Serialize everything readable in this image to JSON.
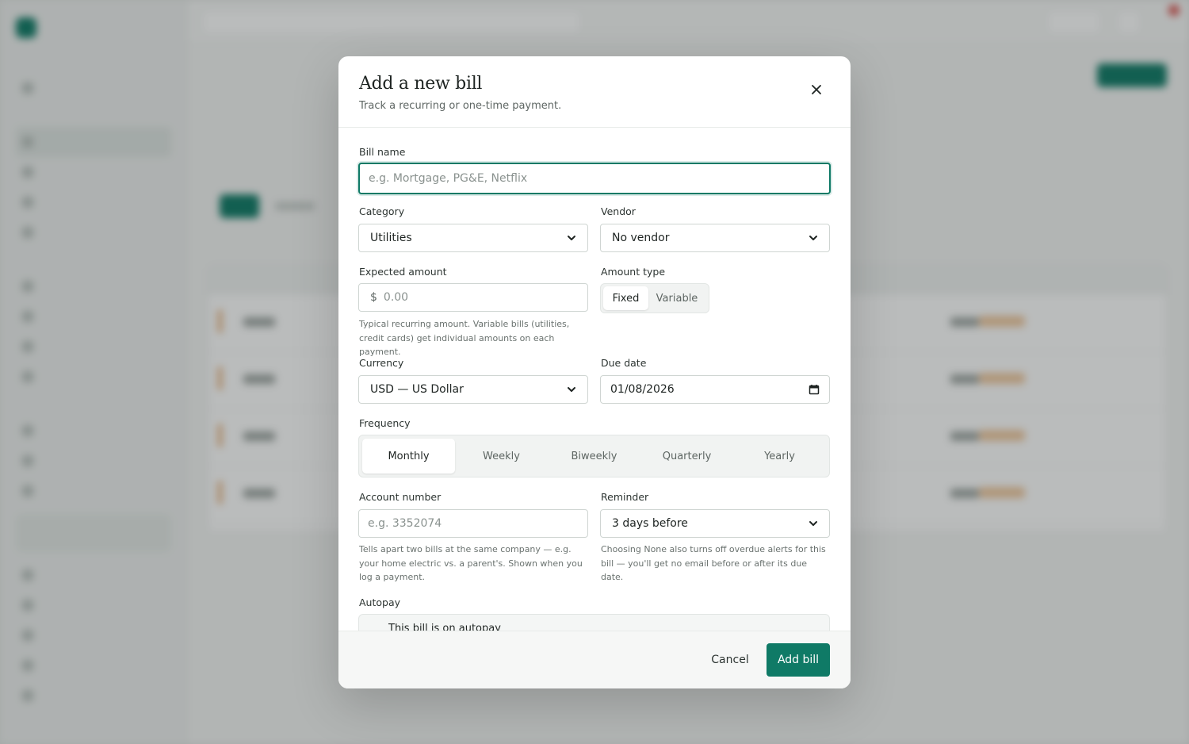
{
  "modal": {
    "title": "Add a new bill",
    "subtitle": "Track a recurring or one-time payment.",
    "close_icon": "close-icon"
  },
  "form": {
    "bill_name": {
      "label": "Bill name",
      "placeholder": "e.g. Mortgage, PG&E, Netflix",
      "value": ""
    },
    "category": {
      "label": "Category",
      "value": "Utilities"
    },
    "vendor": {
      "label": "Vendor",
      "value": "No vendor"
    },
    "expected_amount": {
      "label": "Expected amount",
      "currency_symbol": "$",
      "placeholder": "0.00",
      "help": "Typical recurring amount. Variable bills (utilities, credit cards) get individual amounts on each payment."
    },
    "amount_type": {
      "label": "Amount type",
      "options": [
        "Fixed",
        "Variable"
      ],
      "selected": "Fixed"
    },
    "currency": {
      "label": "Currency",
      "value": "USD — US Dollar"
    },
    "due_date": {
      "label": "Due date",
      "value": "01/08/2026",
      "icon": "calendar-icon"
    },
    "frequency": {
      "label": "Frequency",
      "options": [
        "Monthly",
        "Weekly",
        "Biweekly",
        "Quarterly",
        "Yearly"
      ],
      "selected": "Monthly"
    },
    "account_number": {
      "label": "Account number",
      "placeholder": "e.g. 3352074",
      "help": "Tells apart two bills at the same company — e.g. your home electric vs. a parent's. Shown when you log a payment."
    },
    "reminder": {
      "label": "Reminder",
      "value": "3 days before",
      "help": "Choosing None also turns off overdue alerts for this bill — you'll get no email before or after its due date."
    },
    "autopay": {
      "label": "Autopay",
      "toggle_text": "This bill is on autopay"
    }
  },
  "footer": {
    "cancel_label": "Cancel",
    "submit_label": "Add bill"
  },
  "colors": {
    "accent": "#0f7a66",
    "overlay": "rgba(28,34,32,0.30)"
  }
}
